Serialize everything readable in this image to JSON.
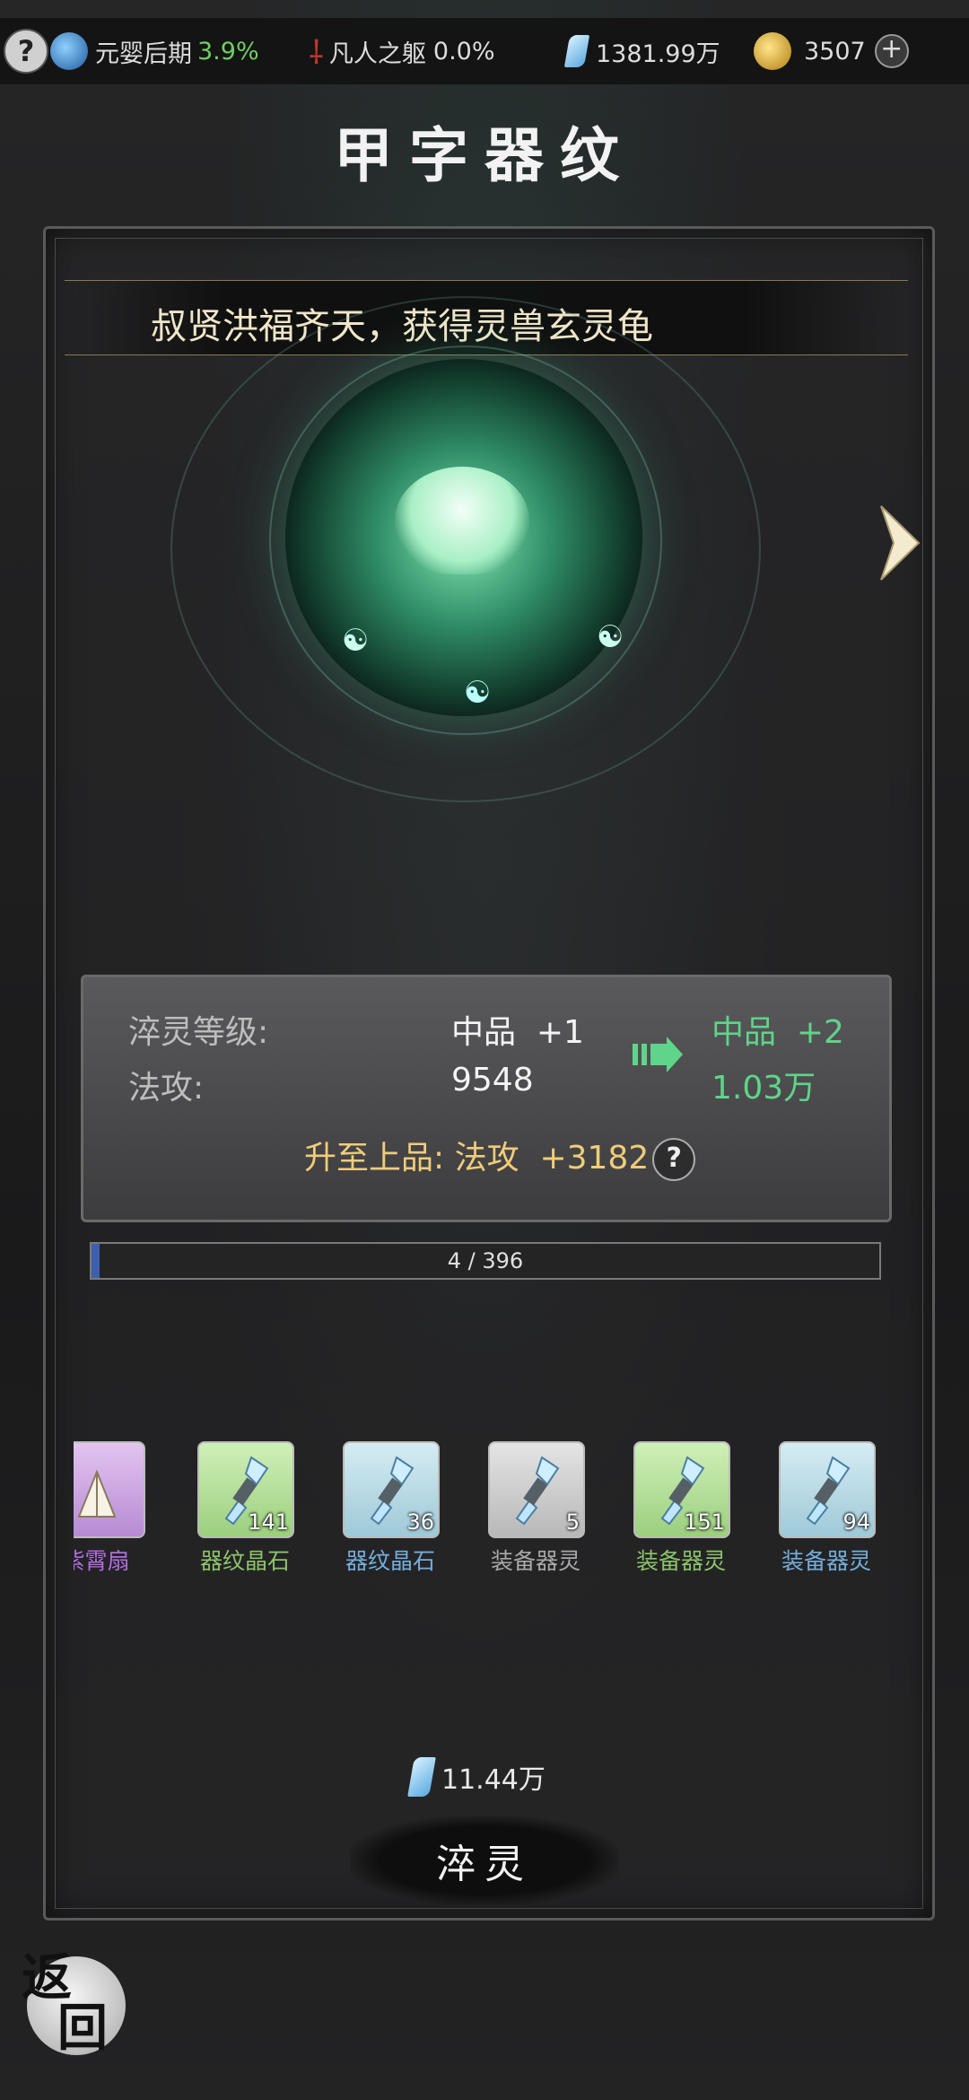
{
  "topbar": {
    "realm_label": "元婴后期",
    "realm_percent": "3.9%",
    "body_label": "凡人之躯",
    "body_percent": "0.0%",
    "spirit_stones": "1381.99万",
    "gold": "3507"
  },
  "title": "甲字器纹",
  "banner": "叔贤洪福齐天，获得灵兽玄灵龟",
  "stats": {
    "level_label": "淬灵等级:",
    "level_current": "中品  +1",
    "level_next": "中品  +2",
    "attack_label": "法攻:",
    "attack_current": "9548",
    "attack_next": "1.03万",
    "upgrade_text": "升至上品: 法攻  +3182"
  },
  "progress": {
    "text": "4 / 396",
    "fraction": 0.0101
  },
  "items": [
    {
      "name": "紫霄扇",
      "count": "",
      "tone": "purple"
    },
    {
      "name": "器纹晶石",
      "count": "141",
      "tone": "green"
    },
    {
      "name": "器纹晶石",
      "count": "36",
      "tone": "blue"
    },
    {
      "name": "装备器灵",
      "count": "5",
      "tone": "grey"
    },
    {
      "name": "装备器灵",
      "count": "151",
      "tone": "green"
    },
    {
      "name": "装备器灵",
      "count": "94",
      "tone": "blue"
    }
  ],
  "cost": "11.44万",
  "refine_button": "淬灵",
  "back_button": [
    "返",
    "回"
  ],
  "colors": {
    "accent_green": "#5fd48a",
    "gold_text": "#f0cc7a",
    "progress_fill": "#3d5fae"
  }
}
